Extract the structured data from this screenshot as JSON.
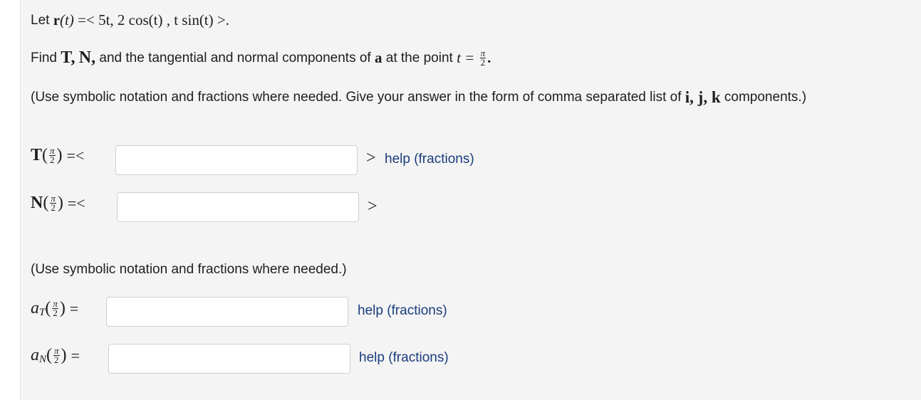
{
  "problem": {
    "let_prefix": "Let",
    "vec_r": "r",
    "r_arg": "(t)",
    "r_def": "=< 5t,  2 cos(t) ,  t sin(t) >.",
    "find_prefix": "Find",
    "T": "T,",
    "N": "N,",
    "find_mid": "and the tangential and normal components of",
    "a": "a",
    "find_suffix": "at the point",
    "t_eq": "t =",
    "pi": "π",
    "two": "2",
    "period": ".",
    "instr1_text": "(Use symbolic notation and fractions where needed. Give your answer in the form of comma separated list of",
    "ijk": "i,  j,  k",
    "instr1_end": "components.)",
    "instr2": "(Use symbolic notation and fractions where needed.)"
  },
  "answers": {
    "T_label": "T",
    "N_label": "N",
    "open_vec": "=<",
    "close_vec": ">",
    "eq": "=",
    "a": "a",
    "sub_T": "T",
    "sub_N": "N",
    "lparen": "(",
    "rparen": ")",
    "T_value": "",
    "N_value": "",
    "aT_value": "",
    "aN_value": "",
    "help_fractions": "help (fractions)"
  }
}
